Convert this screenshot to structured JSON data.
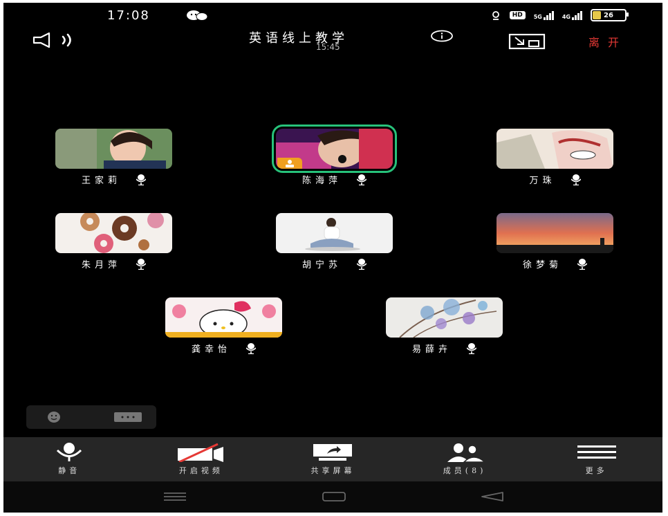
{
  "status_bar": {
    "time": "17:08",
    "network_hd": "HD",
    "network_1": "5G",
    "network_2": "4G",
    "battery": "26"
  },
  "header": {
    "title": "英语线上教学",
    "elapsed": "15:45",
    "leave_label": "离开"
  },
  "participants": [
    {
      "name": "王家莉",
      "active": false
    },
    {
      "name": "陈海萍",
      "active": true
    },
    {
      "name": "万珠",
      "active": false
    },
    {
      "name": "朱月萍",
      "active": false
    },
    {
      "name": "胡宁苏",
      "active": false
    },
    {
      "name": "徐梦菊",
      "active": false
    },
    {
      "name": "龚幸怡",
      "active": false
    },
    {
      "name": "易薛卉",
      "active": false
    }
  ],
  "toolbar": {
    "mute": "静音",
    "video": "开启视频",
    "share": "共享屏幕",
    "members": "成员(8)",
    "more": "更多"
  },
  "icons": {
    "speaker": "speaker-icon",
    "info": "info-icon",
    "pip": "picture-in-picture-icon",
    "mic": "mic-icon",
    "host": "host-badge-icon"
  },
  "colors": {
    "active_border": "#27c27a",
    "leave": "#e53935",
    "host_badge": "#f0a020",
    "toolbar_bg": "#262626"
  }
}
